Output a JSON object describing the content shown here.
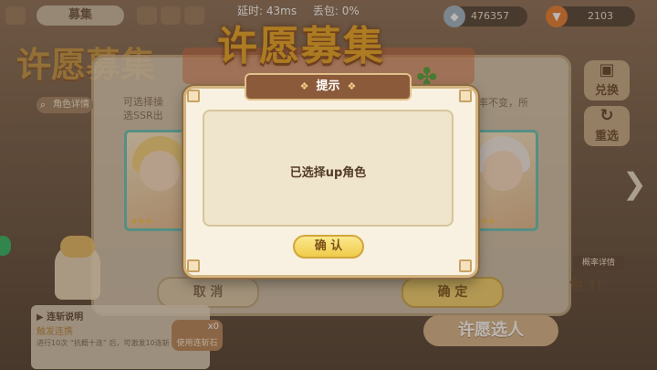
{
  "topbar": {
    "tab_label": "募集",
    "latency_label": "延时: 43ms",
    "packet_loss_label": "丢包: 0%",
    "resources": [
      {
        "icon": "gem-icon",
        "value": "476357"
      },
      {
        "icon": "carrot-icon",
        "value": "2103"
      }
    ]
  },
  "background": {
    "banner_title": "许愿募集",
    "left_title": "许愿募集",
    "search_label": "角色详情",
    "info_left_line1": "可选择操",
    "info_left_line2": "选SSR出",
    "info_right": "率不变，所",
    "side_buttons": [
      {
        "icon": "card-swap-icon",
        "label": "兑换"
      },
      {
        "icon": "refresh-icon",
        "label": "重选"
      }
    ],
    "cancel_label": "取 消",
    "confirm_label": "确 定",
    "chain_panel": {
      "title": "▶ 连斩说明",
      "subtitle": "触发连携",
      "line": "进行10次 “抗概十连” 后，可激发10连斩"
    },
    "chain_button": {
      "count": "x0",
      "label": "使用连斩石"
    },
    "wish_button": "许愿选人",
    "probability_label": "概率详情",
    "right_char_tag": "色 !!"
  },
  "dialog": {
    "title": "提示",
    "message": "已选择up角色",
    "ok_label": "确 认"
  },
  "colors": {
    "dialog_bg": "#f8f1e1",
    "header_brown": "#8b5a3a",
    "ok_yellow": "#f0cb4a",
    "title_orange": "#e8a522",
    "card_border": "#64c4b9"
  }
}
